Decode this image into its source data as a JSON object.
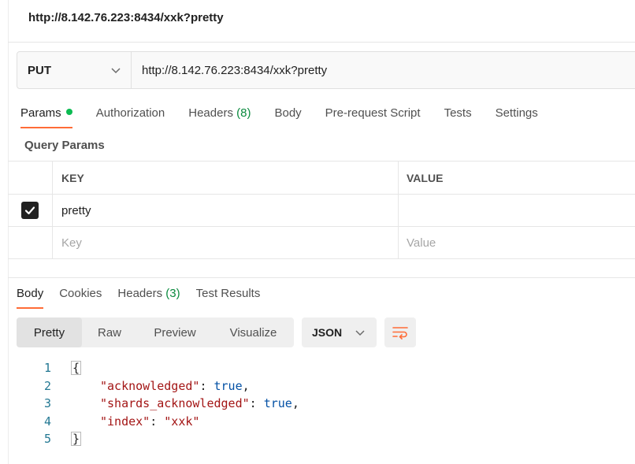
{
  "title": "http://8.142.76.223:8434/xxk?pretty",
  "request": {
    "method": "PUT",
    "url": "http://8.142.76.223:8434/xxk?pretty"
  },
  "request_tabs": {
    "params": "Params",
    "authorization": "Authorization",
    "headers": "Headers",
    "headers_count": "(8)",
    "body": "Body",
    "prerequest": "Pre-request Script",
    "tests": "Tests",
    "settings": "Settings"
  },
  "query_params": {
    "title": "Query Params",
    "col_key": "KEY",
    "col_value": "VALUE",
    "rows": [
      {
        "key": "pretty",
        "value": "",
        "checked": true
      }
    ],
    "key_placeholder": "Key",
    "value_placeholder": "Value"
  },
  "response_tabs": {
    "body": "Body",
    "cookies": "Cookies",
    "headers": "Headers",
    "headers_count": "(3)",
    "test_results": "Test Results"
  },
  "view_modes": {
    "pretty": "Pretty",
    "raw": "Raw",
    "preview": "Preview",
    "visualize": "Visualize"
  },
  "format": "JSON",
  "code_lines": {
    "l1": {
      "num": "1",
      "open": "{"
    },
    "l2": {
      "num": "2",
      "key": "\"acknowledged\"",
      "sep": ": ",
      "val": "true",
      "end": ","
    },
    "l3": {
      "num": "3",
      "key": "\"shards_acknowledged\"",
      "sep": ": ",
      "val": "true",
      "end": ","
    },
    "l4": {
      "num": "4",
      "key": "\"index\"",
      "sep": ": ",
      "val": "\"xxk\""
    },
    "l5": {
      "num": "5",
      "close": "}"
    }
  },
  "colors": {
    "accent": "#ff6c37",
    "status_dot": "#0cbb52",
    "count_green": "#0a8a3e",
    "json_key": "#a31515",
    "json_literal": "#0451a5"
  },
  "icons": {
    "method_dropdown": "chevron-down-icon",
    "format_dropdown": "chevron-down-icon",
    "wrap": "wrap-lines-icon",
    "checkbox": "checkmark-icon"
  }
}
